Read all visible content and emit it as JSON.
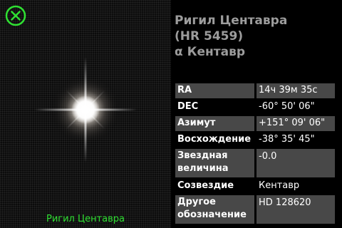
{
  "star_view": {
    "caption": "Ригил Центавра",
    "close_icon": "close-icon",
    "accent_color": "#2fe032"
  },
  "info": {
    "title_lines": [
      "Ригил Центавра",
      "(HR 5459)",
      "α Кентавр"
    ],
    "rows": [
      {
        "label": "RA",
        "value": "14ч 39м 35с"
      },
      {
        "label": "DEC",
        "value": "-60° 50' 06\""
      },
      {
        "label": "Азимут",
        "value": "+151° 09' 06\""
      },
      {
        "label": "Восхождение",
        "value": "-38° 35' 45\""
      },
      {
        "label": "Звездная величина",
        "value": "-0.0"
      },
      {
        "label": "Созвездие",
        "value": "Кентавр"
      },
      {
        "label": "Другое обозначение",
        "value": "HD 128620"
      }
    ]
  }
}
